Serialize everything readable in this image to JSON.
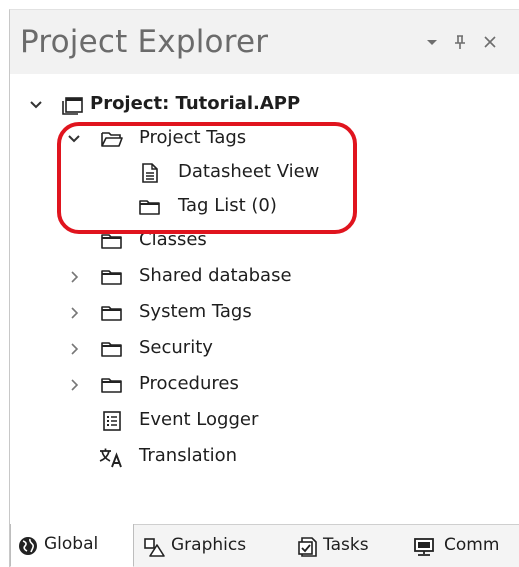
{
  "panel": {
    "title": "Project Explorer",
    "controls": {
      "dropdown": "▾",
      "pin": "⊥",
      "close": "×"
    }
  },
  "tree": {
    "root": {
      "label": "Project: Tutorial.APP",
      "icon": "project-window-icon",
      "expanded": true
    },
    "items": [
      {
        "label": "Project Tags",
        "icon": "folder-open-icon",
        "expanded": true
      },
      {
        "label": "Datasheet View",
        "icon": "document-icon"
      },
      {
        "label": "Tag List (0)",
        "icon": "folder-icon"
      },
      {
        "label": "Classes",
        "icon": "folder-icon"
      },
      {
        "label": "Shared database",
        "icon": "folder-icon",
        "expanded": false
      },
      {
        "label": "System Tags",
        "icon": "folder-icon",
        "expanded": false
      },
      {
        "label": "Security",
        "icon": "folder-icon",
        "expanded": false
      },
      {
        "label": "Procedures",
        "icon": "folder-icon",
        "expanded": false
      },
      {
        "label": "Event Logger",
        "icon": "list-document-icon"
      },
      {
        "label": "Translation",
        "icon": "translate-icon"
      }
    ]
  },
  "tabs": [
    {
      "label": "Global",
      "icon": "globe-icon",
      "active": true
    },
    {
      "label": "Graphics",
      "icon": "graphics-icon",
      "active": false
    },
    {
      "label": "Tasks",
      "icon": "tasks-icon",
      "active": false
    },
    {
      "label": "Comm",
      "icon": "computer-icon",
      "active": false
    }
  ],
  "colors": {
    "highlight_ring": "#e0141e",
    "title_text": "#6b6b6b",
    "titlebar_bg": "#f2f2f2"
  }
}
